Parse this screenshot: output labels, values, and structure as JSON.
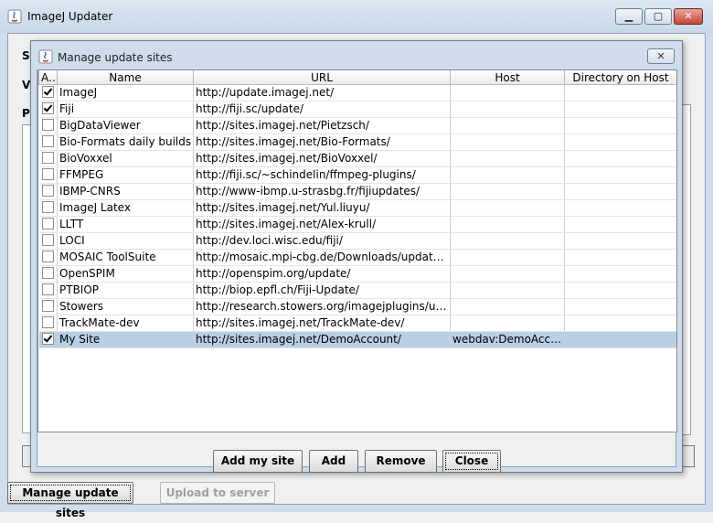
{
  "main": {
    "title": "ImageJ Updater",
    "behind_labels": [
      "S",
      "V",
      "P"
    ],
    "manage_button": "Manage update sites",
    "upload_button": "Upload to server"
  },
  "dialog": {
    "title": "Manage update sites",
    "columns": [
      "A...",
      "Name",
      "URL",
      "Host",
      "Directory on Host"
    ],
    "rows": [
      {
        "active": true,
        "name": "ImageJ",
        "url": "http://update.imagej.net/",
        "host": "",
        "directory": ""
      },
      {
        "active": true,
        "name": "Fiji",
        "url": "http://fiji.sc/update/",
        "host": "",
        "directory": ""
      },
      {
        "active": false,
        "name": "BigDataViewer",
        "url": "http://sites.imagej.net/Pietzsch/",
        "host": "",
        "directory": ""
      },
      {
        "active": false,
        "name": "Bio-Formats daily builds",
        "url": "http://sites.imagej.net/Bio-Formats/",
        "host": "",
        "directory": ""
      },
      {
        "active": false,
        "name": "BioVoxxel",
        "url": "http://sites.imagej.net/BioVoxxel/",
        "host": "",
        "directory": ""
      },
      {
        "active": false,
        "name": "FFMPEG",
        "url": "http://fiji.sc/~schindelin/ffmpeg-plugins/",
        "host": "",
        "directory": ""
      },
      {
        "active": false,
        "name": "IBMP-CNRS",
        "url": "http://www-ibmp.u-strasbg.fr/fijiupdates/",
        "host": "",
        "directory": ""
      },
      {
        "active": false,
        "name": "ImageJ Latex",
        "url": "http://sites.imagej.net/Yul.liuyu/",
        "host": "",
        "directory": ""
      },
      {
        "active": false,
        "name": "LLTT",
        "url": "http://sites.imagej.net/Alex-krull/",
        "host": "",
        "directory": ""
      },
      {
        "active": false,
        "name": "LOCI",
        "url": "http://dev.loci.wisc.edu/fiji/",
        "host": "",
        "directory": ""
      },
      {
        "active": false,
        "name": "MOSAIC ToolSuite",
        "url": "http://mosaic.mpi-cbg.de/Downloads/update/Fiji/...",
        "host": "",
        "directory": ""
      },
      {
        "active": false,
        "name": "OpenSPIM",
        "url": "http://openspim.org/update/",
        "host": "",
        "directory": ""
      },
      {
        "active": false,
        "name": "PTBIOP",
        "url": "http://biop.epfl.ch/Fiji-Update/",
        "host": "",
        "directory": ""
      },
      {
        "active": false,
        "name": "Stowers",
        "url": "http://research.stowers.org/imagejplugins/updat...",
        "host": "",
        "directory": ""
      },
      {
        "active": false,
        "name": "TrackMate-dev",
        "url": "http://sites.imagej.net/TrackMate-dev/",
        "host": "",
        "directory": ""
      },
      {
        "active": true,
        "name": "My Site",
        "url": "http://sites.imagej.net/DemoAccount/",
        "host": "webdav:DemoAccount",
        "directory": "",
        "selected": true
      }
    ],
    "buttons": {
      "add_my_site": "Add my site",
      "add": "Add",
      "remove": "Remove",
      "close": "Close"
    }
  }
}
